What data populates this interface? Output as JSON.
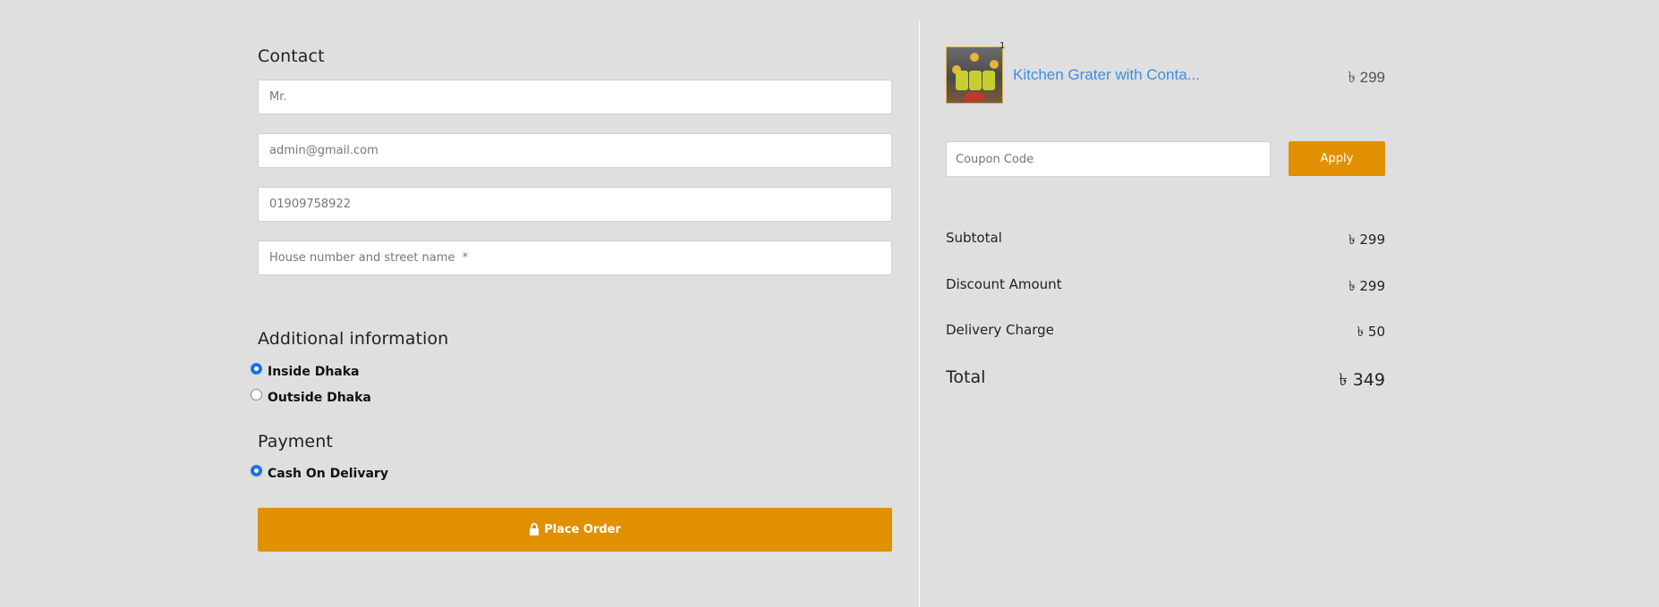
{
  "contact": {
    "title": "Contact",
    "name_placeholder": "Mr.",
    "email_placeholder": "admin@gmail.com",
    "phone_placeholder": "01909758922",
    "address_placeholder": "House number and street name  *"
  },
  "additional": {
    "title": "Additional information",
    "options": [
      {
        "label": "Inside Dhaka",
        "selected": true
      },
      {
        "label": "Outside Dhaka",
        "selected": false
      }
    ]
  },
  "payment": {
    "title": "Payment",
    "options": [
      {
        "label": "Cash On Delivary",
        "selected": true
      }
    ]
  },
  "place_order": {
    "label": "Place Order",
    "icon": "lock-icon"
  },
  "cart": {
    "items": [
      {
        "quantity": "1",
        "name": "Kitchen Grater with Conta...",
        "price": "৳ 299"
      }
    ]
  },
  "coupon": {
    "placeholder": "Coupon Code",
    "apply_label": "Apply"
  },
  "summary": {
    "subtotal_label": "Subtotal",
    "subtotal_value": "৳ 299",
    "discount_label": "Discount Amount",
    "discount_value": "৳ 299",
    "delivery_label": "Delivery Charge",
    "delivery_value": "৳ 50",
    "total_label": "Total",
    "total_value": "৳ 349"
  },
  "colors": {
    "background": "#dfdfdf",
    "accent": "#e09000",
    "link": "#3d8fe0",
    "radio": "#1a73e8"
  }
}
